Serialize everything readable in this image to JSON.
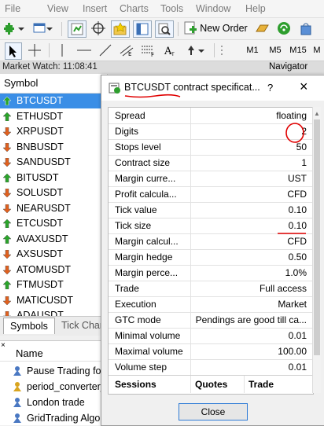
{
  "menu": [
    "File",
    "View",
    "Insert",
    "Charts",
    "Tools",
    "Window",
    "Help"
  ],
  "toolbar": {
    "new_order_label": "New Order",
    "timeframes": [
      "M1",
      "M5",
      "M15",
      "M"
    ]
  },
  "market_watch": {
    "title": "Market Watch: 11:08:41",
    "column_header": "Symbol",
    "symbols": [
      {
        "name": "BTCUSDT",
        "dir": "up",
        "selected": true
      },
      {
        "name": "ETHUSDT",
        "dir": "up"
      },
      {
        "name": "XRPUSDT",
        "dir": "down"
      },
      {
        "name": "BNBUSDT",
        "dir": "down"
      },
      {
        "name": "SANDUSDT",
        "dir": "down"
      },
      {
        "name": "BITUSDT",
        "dir": "up"
      },
      {
        "name": "SOLUSDT",
        "dir": "down"
      },
      {
        "name": "NEARUSDT",
        "dir": "down"
      },
      {
        "name": "ETCUSDT",
        "dir": "up"
      },
      {
        "name": "AVAXUSDT",
        "dir": "up"
      },
      {
        "name": "AXSUSDT",
        "dir": "down"
      },
      {
        "name": "ATOMUSDT",
        "dir": "down"
      },
      {
        "name": "FTMUSDT",
        "dir": "up"
      },
      {
        "name": "MATICUSDT",
        "dir": "down"
      },
      {
        "name": "ADAUSDT",
        "dir": "down"
      }
    ],
    "tabs": [
      "Symbols",
      "Tick Char"
    ]
  },
  "navigator": {
    "title": "Navigator",
    "column_header": "Name",
    "items": [
      "Pause Trading for",
      "period_converter_",
      "London trade",
      "GridTrading Algor"
    ]
  },
  "dialog": {
    "title": "BTCUSDT contract specificat...",
    "help": "?",
    "rows": [
      {
        "key": "Spread",
        "value": "floating"
      },
      {
        "key": "Digits",
        "value": "2"
      },
      {
        "key": "Stops level",
        "value": "50"
      },
      {
        "key": "Contract size",
        "value": "1"
      },
      {
        "key": "Margin curre...",
        "value": "UST"
      },
      {
        "key": "Profit calcula...",
        "value": "CFD"
      },
      {
        "key": "Tick value",
        "value": "0.10"
      },
      {
        "key": "Tick size",
        "value": "0.10"
      },
      {
        "key": "Margin calcul...",
        "value": "CFD"
      },
      {
        "key": "Margin hedge",
        "value": "0.50"
      },
      {
        "key": "Margin perce...",
        "value": "1.0%"
      },
      {
        "key": "Trade",
        "value": "Full access"
      },
      {
        "key": "Execution",
        "value": "Market"
      },
      {
        "key": "GTC mode",
        "value": "Pendings are good till ca..."
      },
      {
        "key": "Minimal volume",
        "value": "0.01"
      },
      {
        "key": "Maximal volume",
        "value": "100.00"
      },
      {
        "key": "Volume step",
        "value": "0.01"
      }
    ],
    "sessions_header": [
      "Sessions",
      "Quotes",
      "Trade"
    ],
    "close_label": "Close"
  },
  "colors": {
    "selection": "#3a8ee6",
    "up_arrow": "#2aa52a",
    "down_arrow": "#e0601e",
    "annotation": "#e00000"
  }
}
